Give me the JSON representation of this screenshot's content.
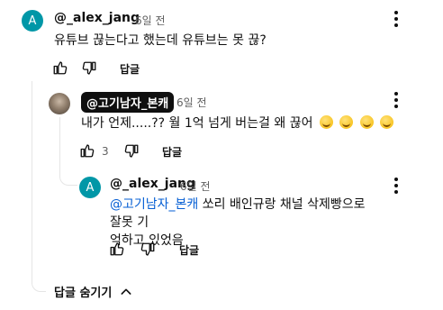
{
  "comment1": {
    "avatar_letter": "A",
    "author": "@_alex_jang",
    "time": "6일 전",
    "text": "유튜브 끊는다고 했는데 유튜브는 못 끊?",
    "reply_label": "답글"
  },
  "reply1": {
    "author": "@고기남자_본캐",
    "time": "6일 전",
    "text": "내가 언제.....?? 월 1억 넘게 버는걸 왜 끊어",
    "likes": "3",
    "reply_label": "답글"
  },
  "reply2": {
    "avatar_letter": "A",
    "author": "@_alex_jang",
    "time": "6일 전",
    "mention": "@고기남자_본캐",
    "text_line1": " 쏘리 배인규랑 채널 삭제빵으로 잘못 기",
    "text_line2": "억하고 있었음",
    "reply_label": "답글"
  },
  "hide_replies_label": "답글 숨기기",
  "colors": {
    "avatar": "#0097a7",
    "mention": "#065fd4"
  }
}
